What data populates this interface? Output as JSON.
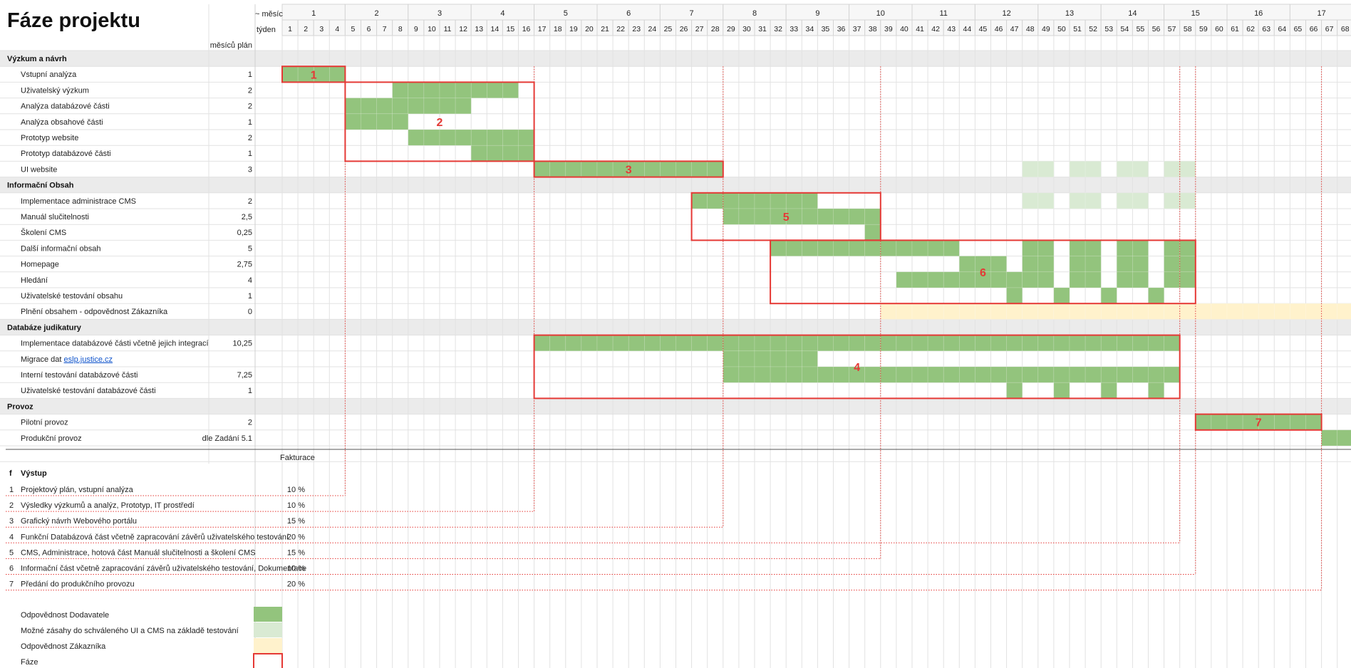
{
  "title": "Fáze projektu",
  "header": {
    "month_label": "~ měsíc",
    "week_label": "týden",
    "plan_label": "měsíců plán"
  },
  "months": [
    "1",
    "2",
    "3",
    "4",
    "5",
    "6",
    "7",
    "8",
    "9",
    "10",
    "11",
    "12",
    "13",
    "14",
    "15",
    "16",
    "17"
  ],
  "weeks": [
    "1",
    "2",
    "3",
    "4",
    "5",
    "6",
    "7",
    "8",
    "9",
    "10",
    "11",
    "12",
    "13",
    "14",
    "15",
    "16",
    "17",
    "18",
    "19",
    "20",
    "21",
    "22",
    "23",
    "24",
    "25",
    "26",
    "27",
    "28",
    "29",
    "30",
    "31",
    "32",
    "33",
    "34",
    "35",
    "36",
    "37",
    "38",
    "39",
    "40",
    "41",
    "42",
    "43",
    "44",
    "45",
    "46",
    "47",
    "48",
    "49",
    "50",
    "51",
    "52",
    "53",
    "54",
    "55",
    "56",
    "57",
    "58",
    "59",
    "60",
    "61",
    "62",
    "63",
    "64",
    "65",
    "66",
    "67",
    "68"
  ],
  "rows": [
    {
      "kind": "section",
      "label": "Výzkum a návrh"
    },
    {
      "kind": "task",
      "label": "Vstupní analýza",
      "plan": "1"
    },
    {
      "kind": "task",
      "label": "Uživatelský výzkum",
      "plan": "2"
    },
    {
      "kind": "task",
      "label": "Analýza databázové části",
      "plan": "2"
    },
    {
      "kind": "task",
      "label": "Analýza obsahové části",
      "plan": "1"
    },
    {
      "kind": "task",
      "label": "Prototyp website",
      "plan": "2"
    },
    {
      "kind": "task",
      "label": "Prototyp databázové části",
      "plan": "1"
    },
    {
      "kind": "task",
      "label": "UI website",
      "plan": "3"
    },
    {
      "kind": "section",
      "label": "Informační Obsah"
    },
    {
      "kind": "task",
      "label": "Implementace administrace CMS",
      "plan": "2"
    },
    {
      "kind": "task",
      "label": "Manuál slučitelnosti",
      "plan": "2,5"
    },
    {
      "kind": "task",
      "label": "Školení CMS",
      "plan": "0,25"
    },
    {
      "kind": "task",
      "label": "Další informační obsah",
      "plan": "5"
    },
    {
      "kind": "task",
      "label": "Homepage",
      "plan": "2,75"
    },
    {
      "kind": "task",
      "label": "Hledání",
      "plan": "4"
    },
    {
      "kind": "task",
      "label": "Uživatelské testování obsahu",
      "plan": "1"
    },
    {
      "kind": "task",
      "label": "Plnění obsahem - odpovědnost Zákazníka",
      "plan": "0"
    },
    {
      "kind": "section",
      "label": "Databáze judikatury"
    },
    {
      "kind": "task",
      "label": "Implementace databázové části včetně jejich integrací",
      "plan": "10,25"
    },
    {
      "kind": "task",
      "label": "Migrace dat ",
      "link": "eslp.justice.cz",
      "plan": ""
    },
    {
      "kind": "task",
      "label": "Interní testování databázové části",
      "plan": "7,25"
    },
    {
      "kind": "task",
      "label": "Uživatelské testování databázové části",
      "plan": "1"
    },
    {
      "kind": "section",
      "label": "Provoz"
    },
    {
      "kind": "task",
      "label": "Pilotní provoz",
      "plan": "2"
    },
    {
      "kind": "task",
      "label": "Produkční provoz",
      "plan": "dle Zadání 5.1"
    }
  ],
  "chart_data": {
    "type": "gantt",
    "unit": "week",
    "bars": [
      {
        "row": 1,
        "cat": "dodavatel",
        "ranges": [
          [
            1,
            4
          ]
        ]
      },
      {
        "row": 2,
        "cat": "dodavatel",
        "ranges": [
          [
            8,
            15
          ]
        ]
      },
      {
        "row": 3,
        "cat": "dodavatel",
        "ranges": [
          [
            5,
            12
          ]
        ]
      },
      {
        "row": 4,
        "cat": "dodavatel",
        "ranges": [
          [
            5,
            8
          ]
        ]
      },
      {
        "row": 5,
        "cat": "dodavatel",
        "ranges": [
          [
            9,
            16
          ]
        ]
      },
      {
        "row": 6,
        "cat": "dodavatel",
        "ranges": [
          [
            13,
            16
          ]
        ]
      },
      {
        "row": 7,
        "cat": "dodavatel",
        "ranges": [
          [
            17,
            28
          ]
        ]
      },
      {
        "row": 7,
        "cat": "zasahy",
        "ranges": [
          [
            48,
            49
          ],
          [
            51,
            52
          ],
          [
            54,
            55
          ],
          [
            57,
            58
          ]
        ]
      },
      {
        "row": 9,
        "cat": "dodavatel",
        "ranges": [
          [
            27,
            34
          ]
        ]
      },
      {
        "row": 9,
        "cat": "zasahy",
        "ranges": [
          [
            48,
            49
          ],
          [
            51,
            52
          ],
          [
            54,
            55
          ],
          [
            57,
            58
          ]
        ]
      },
      {
        "row": 10,
        "cat": "dodavatel",
        "ranges": [
          [
            29,
            38
          ]
        ]
      },
      {
        "row": 11,
        "cat": "dodavatel",
        "ranges": [
          [
            38,
            38
          ]
        ]
      },
      {
        "row": 12,
        "cat": "dodavatel",
        "ranges": [
          [
            32,
            43
          ],
          [
            48,
            49
          ],
          [
            51,
            52
          ],
          [
            54,
            55
          ],
          [
            57,
            58
          ]
        ]
      },
      {
        "row": 13,
        "cat": "dodavatel",
        "ranges": [
          [
            44,
            46
          ],
          [
            48,
            49
          ],
          [
            51,
            52
          ],
          [
            54,
            55
          ],
          [
            57,
            58
          ]
        ]
      },
      {
        "row": 14,
        "cat": "dodavatel",
        "ranges": [
          [
            40,
            49
          ],
          [
            51,
            52
          ],
          [
            54,
            55
          ],
          [
            57,
            58
          ]
        ]
      },
      {
        "row": 15,
        "cat": "dodavatel",
        "ranges": [
          [
            47,
            47
          ],
          [
            50,
            50
          ],
          [
            53,
            53
          ],
          [
            56,
            56
          ]
        ]
      },
      {
        "row": 16,
        "cat": "zakaznik",
        "ranges": [
          [
            39,
            68
          ]
        ]
      },
      {
        "row": 18,
        "cat": "dodavatel",
        "ranges": [
          [
            17,
            57
          ]
        ]
      },
      {
        "row": 19,
        "cat": "dodavatel",
        "ranges": [
          [
            29,
            34
          ]
        ]
      },
      {
        "row": 20,
        "cat": "dodavatel",
        "ranges": [
          [
            29,
            57
          ]
        ]
      },
      {
        "row": 21,
        "cat": "dodavatel",
        "ranges": [
          [
            47,
            47
          ],
          [
            50,
            50
          ],
          [
            53,
            53
          ],
          [
            56,
            56
          ]
        ]
      },
      {
        "row": 23,
        "cat": "dodavatel",
        "ranges": [
          [
            59,
            66
          ]
        ]
      },
      {
        "row": 24,
        "cat": "dodavatel",
        "ranges": [
          [
            67,
            68
          ]
        ]
      }
    ],
    "phases": [
      {
        "label": "1",
        "weeks": [
          1,
          4
        ],
        "rows": [
          1,
          1
        ]
      },
      {
        "label": "2",
        "weeks": [
          5,
          16
        ],
        "rows": [
          2,
          6
        ]
      },
      {
        "label": "3",
        "weeks": [
          17,
          28
        ],
        "rows": [
          7,
          7
        ]
      },
      {
        "label": "5",
        "weeks": [
          27,
          38
        ],
        "rows": [
          9,
          11
        ]
      },
      {
        "label": "6",
        "weeks": [
          32,
          58
        ],
        "rows": [
          12,
          15
        ]
      },
      {
        "label": "4",
        "weeks": [
          17,
          57
        ],
        "rows": [
          18,
          21
        ]
      },
      {
        "label": "7",
        "weeks": [
          59,
          66
        ],
        "rows": [
          23,
          23
        ]
      }
    ],
    "deliverable_end_weeks": [
      4,
      16,
      28,
      57,
      38,
      58,
      66
    ]
  },
  "billing": {
    "header": "Fakturace",
    "col_f": "f",
    "col_output": "Výstup",
    "items": [
      {
        "n": "1",
        "text": "Projektový plán, vstupní analýza",
        "pct": "10 %"
      },
      {
        "n": "2",
        "text": "Výsledky výzkumů a analýz, Prototyp, IT prostředí",
        "pct": "10 %"
      },
      {
        "n": "3",
        "text": "Grafický návrh Webového portálu",
        "pct": "15 %"
      },
      {
        "n": "4",
        "text": "Funkční Databázová část včetně zapracování závěrů uživatelského testování",
        "pct": "20 %"
      },
      {
        "n": "5",
        "text": "CMS, Administrace, hotová část Manuál slučitelnosti a školení CMS",
        "pct": "15 %"
      },
      {
        "n": "6",
        "text": "Informační část včetně zapracování závěrů uživatelského testování, Dokumentace",
        "pct": "10 %"
      },
      {
        "n": "7",
        "text": "Předání do produkčního provozu",
        "pct": "20 %"
      }
    ]
  },
  "legend": [
    {
      "cat": "dodavatel",
      "text": "Odpovědnost Dodavatele"
    },
    {
      "cat": "zasahy",
      "text": "Možné zásahy do schváleného UI a CMS na základě testování"
    },
    {
      "cat": "zakaznik",
      "text": "Odpovědnost Zákazníka"
    },
    {
      "cat": "faze",
      "text": "Fáze"
    }
  ],
  "colors": {
    "dodavatel": "#93c47d",
    "zasahy": "#d9ead3",
    "zakaznik": "#fff2cc",
    "faze": "#e53935",
    "section_bg": "#ebebeb",
    "grid": "#d4d4d4",
    "link": "#1155cc"
  }
}
